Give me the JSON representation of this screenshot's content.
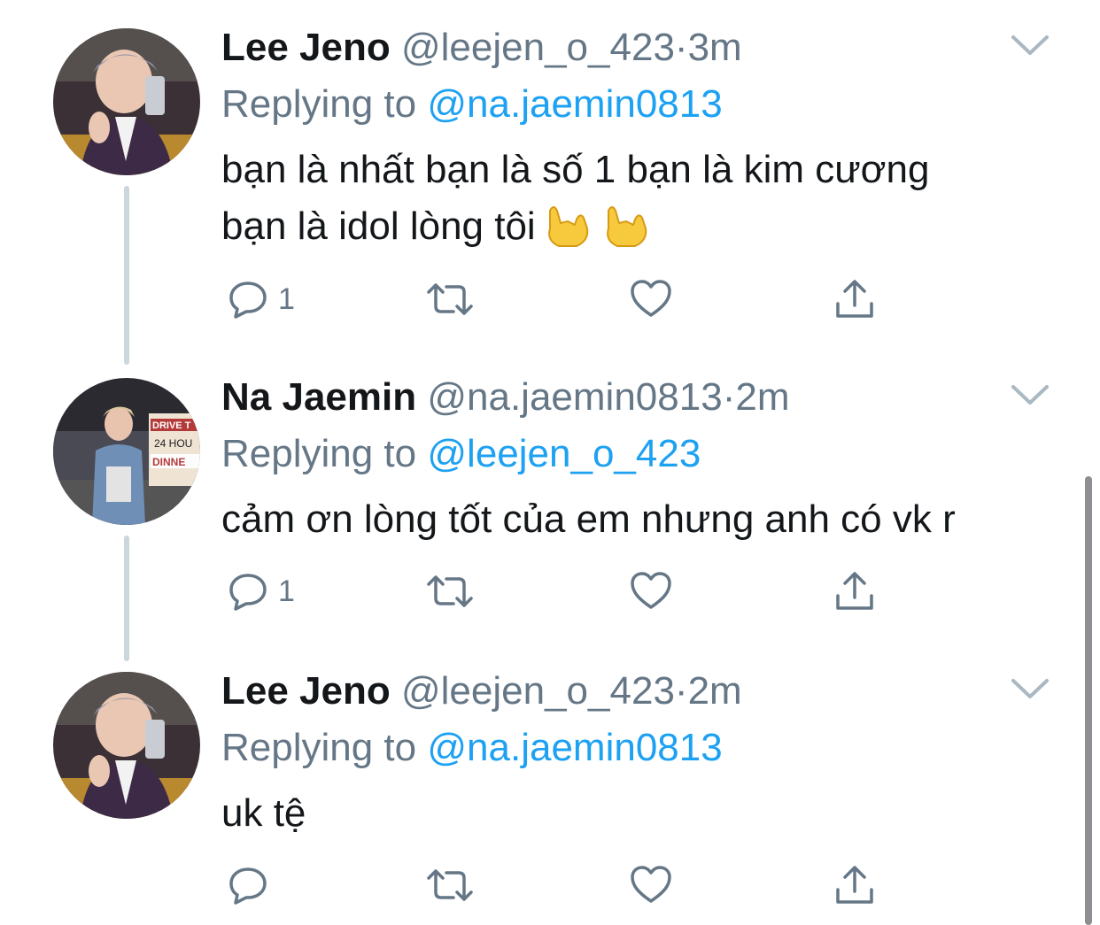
{
  "tweets": [
    {
      "name": "Lee Jeno",
      "handle": "@leejen_o_423",
      "dot": "·",
      "time": "3m",
      "replying_prefix": "Replying to",
      "replying_to": "@na.jaemin0813",
      "text_line1": "bạn là nhất bạn là số 1 bạn là kim cương",
      "text_line2": "bạn là idol lòng tôi",
      "reply_count": "1",
      "emoji": "sign-of-horns-emoji"
    },
    {
      "name": "Na Jaemin",
      "handle": "@na.jaemin0813",
      "dot": "·",
      "time": "2m",
      "replying_prefix": "Replying to",
      "replying_to": "@leejen_o_423",
      "text_line1": "cảm ơn lòng tốt của em nhưng anh có vk r",
      "reply_count": "1",
      "avatar_sign_text": [
        "DRIVE T",
        "24 HOU",
        "DINNE"
      ]
    },
    {
      "name": "Lee Jeno",
      "handle": "@leejen_o_423",
      "dot": "·",
      "time": "2m",
      "replying_prefix": "Replying to",
      "replying_to": "@na.jaemin0813",
      "text_line1": "uk tệ",
      "reply_count": ""
    }
  ],
  "icons": {
    "reply": "reply-icon",
    "retweet": "retweet-icon",
    "like": "heart-icon",
    "share": "share-icon",
    "more": "chevron-down-icon"
  },
  "colors": {
    "link": "#1da1f2",
    "secondary": "#657786",
    "thread_line": "#ccd6dd"
  }
}
